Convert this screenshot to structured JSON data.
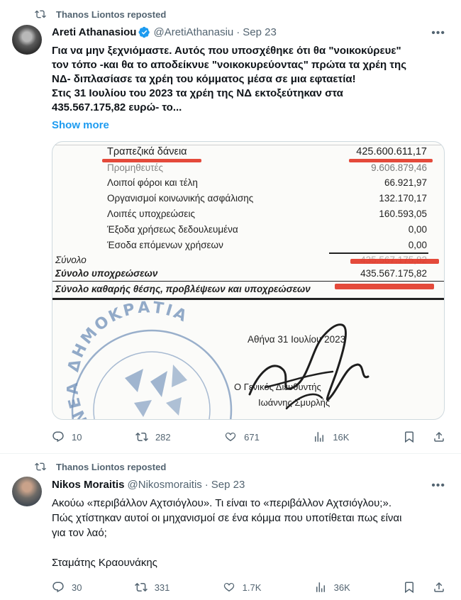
{
  "tweets": [
    {
      "repost_label": "Thanos Liontos reposted",
      "author_name": "Areti Athanasiou",
      "handle": "@AretiAthanasiu",
      "date": "Sep 23",
      "text_lines": [
        "Για να μην ξεχνιόμαστε. Αυτός που υποσχέθηκε ότι θα \"νοικοκύρευε\"",
        "τον τόπο -και θα το αποδείκνυε \"νοικοκυρεύοντας\" πρώτα τα χρέη της",
        "ΝΔ-  διπλασίασε τα χρέη του κόμματος μέσα σε μια εφταετία!",
        "Στις 31 Ιουλίου του 2023 τα χρέη της ΝΔ εκτοξεύτηκαν στα",
        "435.567.175,82 ευρώ- το..."
      ],
      "show_more": "Show more",
      "replies": "10",
      "reposts": "282",
      "likes": "671",
      "views": "16K"
    },
    {
      "repost_label": "Thanos Liontos reposted",
      "author_name": "Nikos Moraitis",
      "handle": "@Nikosmoraitis",
      "date": "Sep 23",
      "text_lines": [
        "Ακούω «περιβάλλον Αχτσιόγλου». Τι είναι το «περιβάλλον Αχτσιόγλου;».",
        "Πώς χτίστηκαν αυτοί οι μηχανισμοί σε ένα κόμμα που υποτίθεται πως είναι",
        "για τον λαό;"
      ],
      "signature": "Σταμάτης Κραουνάκης",
      "replies": "30",
      "reposts": "331",
      "likes": "1.7K",
      "views": "36K"
    }
  ],
  "document": {
    "rows": [
      {
        "label": "Τραπεζικά δάνεια",
        "value": "425.600.611,17"
      },
      {
        "label": "Προμηθευτές",
        "value": "9.606.879,46"
      },
      {
        "label": "Λοιποί φόροι και τέλη",
        "value": "66.921,97"
      },
      {
        "label": "Οργανισμοί κοινωνικής ασφάλισης",
        "value": "132.170,17"
      },
      {
        "label": "Λοιπές υποχρεώσεις",
        "value": "160.593,05"
      },
      {
        "label": "Έξοδα χρήσεως δεδουλευμένα",
        "value": "0,00"
      },
      {
        "label": "Έσοδα επόμενων χρήσεων",
        "value": "0,00"
      }
    ],
    "sum_label": "Σύνολο",
    "sum_value": "435.567.175,82",
    "total_label": "Σύνολο υποχρεώσεων",
    "total_value": "435.567.175,82",
    "net_label": "Σύνολο καθαρής θέσης, προβλέψεων και υποχρεώσεων",
    "place_date": "Αθήνα 31 Ιουλίου 2023",
    "signer_title": "Ο Γενικός Διευθυντής",
    "signer_name": "Ιωάννης Σμυρλής",
    "seal_text": "ΝΕΑ ΔΗΜΟΚΡΑΤΙΑ"
  },
  "colors": {
    "accent": "#1d9bf0",
    "muted": "#536471",
    "redact": "#e23b2a",
    "seal": "#6f8fb8"
  },
  "icons": [
    "repost-icon",
    "verified-icon",
    "more-icon",
    "reply-icon",
    "retweet-icon",
    "like-icon",
    "views-icon",
    "bookmark-icon",
    "share-icon"
  ]
}
